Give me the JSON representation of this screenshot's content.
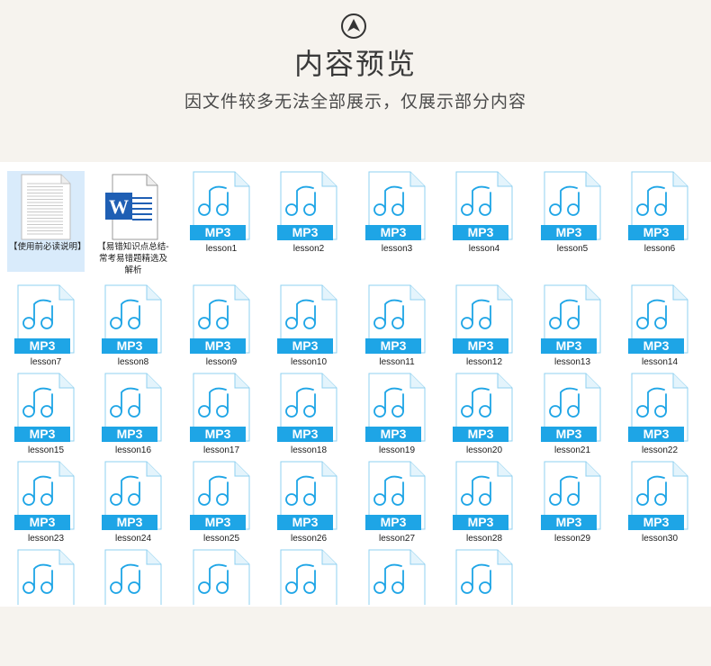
{
  "header": {
    "logo_icon": "chevron-up-circle-icon",
    "title": "内容预览",
    "subtitle": "因文件较多无法全部展示，仅展示部分内容"
  },
  "colors": {
    "background": "#f6f3ee",
    "panel": "#ffffff",
    "mp3_accent": "#1ea5e6",
    "word_blue": "#1f5fb4",
    "selection": "#d9ebfb"
  },
  "files": [
    {
      "label": "【使用前必读说明】",
      "icon": "text-document-icon",
      "selected": true
    },
    {
      "label": "【易错知识点总结-常考易错题精选及解析",
      "icon": "word-document-icon"
    },
    {
      "label": "lesson1",
      "icon": "mp3-file-icon",
      "badge": "MP3"
    },
    {
      "label": "lesson2",
      "icon": "mp3-file-icon",
      "badge": "MP3"
    },
    {
      "label": "lesson3",
      "icon": "mp3-file-icon",
      "badge": "MP3"
    },
    {
      "label": "lesson4",
      "icon": "mp3-file-icon",
      "badge": "MP3"
    },
    {
      "label": "lesson5",
      "icon": "mp3-file-icon",
      "badge": "MP3"
    },
    {
      "label": "lesson6",
      "icon": "mp3-file-icon",
      "badge": "MP3"
    },
    {
      "label": "lesson7",
      "icon": "mp3-file-icon",
      "badge": "MP3"
    },
    {
      "label": "lesson8",
      "icon": "mp3-file-icon",
      "badge": "MP3"
    },
    {
      "label": "lesson9",
      "icon": "mp3-file-icon",
      "badge": "MP3"
    },
    {
      "label": "lesson10",
      "icon": "mp3-file-icon",
      "badge": "MP3"
    },
    {
      "label": "lesson11",
      "icon": "mp3-file-icon",
      "badge": "MP3"
    },
    {
      "label": "lesson12",
      "icon": "mp3-file-icon",
      "badge": "MP3"
    },
    {
      "label": "lesson13",
      "icon": "mp3-file-icon",
      "badge": "MP3"
    },
    {
      "label": "lesson14",
      "icon": "mp3-file-icon",
      "badge": "MP3"
    },
    {
      "label": "lesson15",
      "icon": "mp3-file-icon",
      "badge": "MP3"
    },
    {
      "label": "lesson16",
      "icon": "mp3-file-icon",
      "badge": "MP3"
    },
    {
      "label": "lesson17",
      "icon": "mp3-file-icon",
      "badge": "MP3"
    },
    {
      "label": "lesson18",
      "icon": "mp3-file-icon",
      "badge": "MP3"
    },
    {
      "label": "lesson19",
      "icon": "mp3-file-icon",
      "badge": "MP3"
    },
    {
      "label": "lesson20",
      "icon": "mp3-file-icon",
      "badge": "MP3"
    },
    {
      "label": "lesson21",
      "icon": "mp3-file-icon",
      "badge": "MP3"
    },
    {
      "label": "lesson22",
      "icon": "mp3-file-icon",
      "badge": "MP3"
    },
    {
      "label": "lesson23",
      "icon": "mp3-file-icon",
      "badge": "MP3"
    },
    {
      "label": "lesson24",
      "icon": "mp3-file-icon",
      "badge": "MP3"
    },
    {
      "label": "lesson25",
      "icon": "mp3-file-icon",
      "badge": "MP3"
    },
    {
      "label": "lesson26",
      "icon": "mp3-file-icon",
      "badge": "MP3"
    },
    {
      "label": "lesson27",
      "icon": "mp3-file-icon",
      "badge": "MP3"
    },
    {
      "label": "lesson28",
      "icon": "mp3-file-icon",
      "badge": "MP3"
    },
    {
      "label": "lesson29",
      "icon": "mp3-file-icon",
      "badge": "MP3"
    },
    {
      "label": "lesson30",
      "icon": "mp3-file-icon",
      "badge": "MP3"
    },
    {
      "label": "",
      "icon": "mp3-file-icon"
    },
    {
      "label": "",
      "icon": "mp3-file-icon"
    },
    {
      "label": "",
      "icon": "mp3-file-icon"
    },
    {
      "label": "",
      "icon": "mp3-file-icon"
    },
    {
      "label": "",
      "icon": "mp3-file-icon"
    },
    {
      "label": "",
      "icon": "mp3-file-icon"
    }
  ]
}
